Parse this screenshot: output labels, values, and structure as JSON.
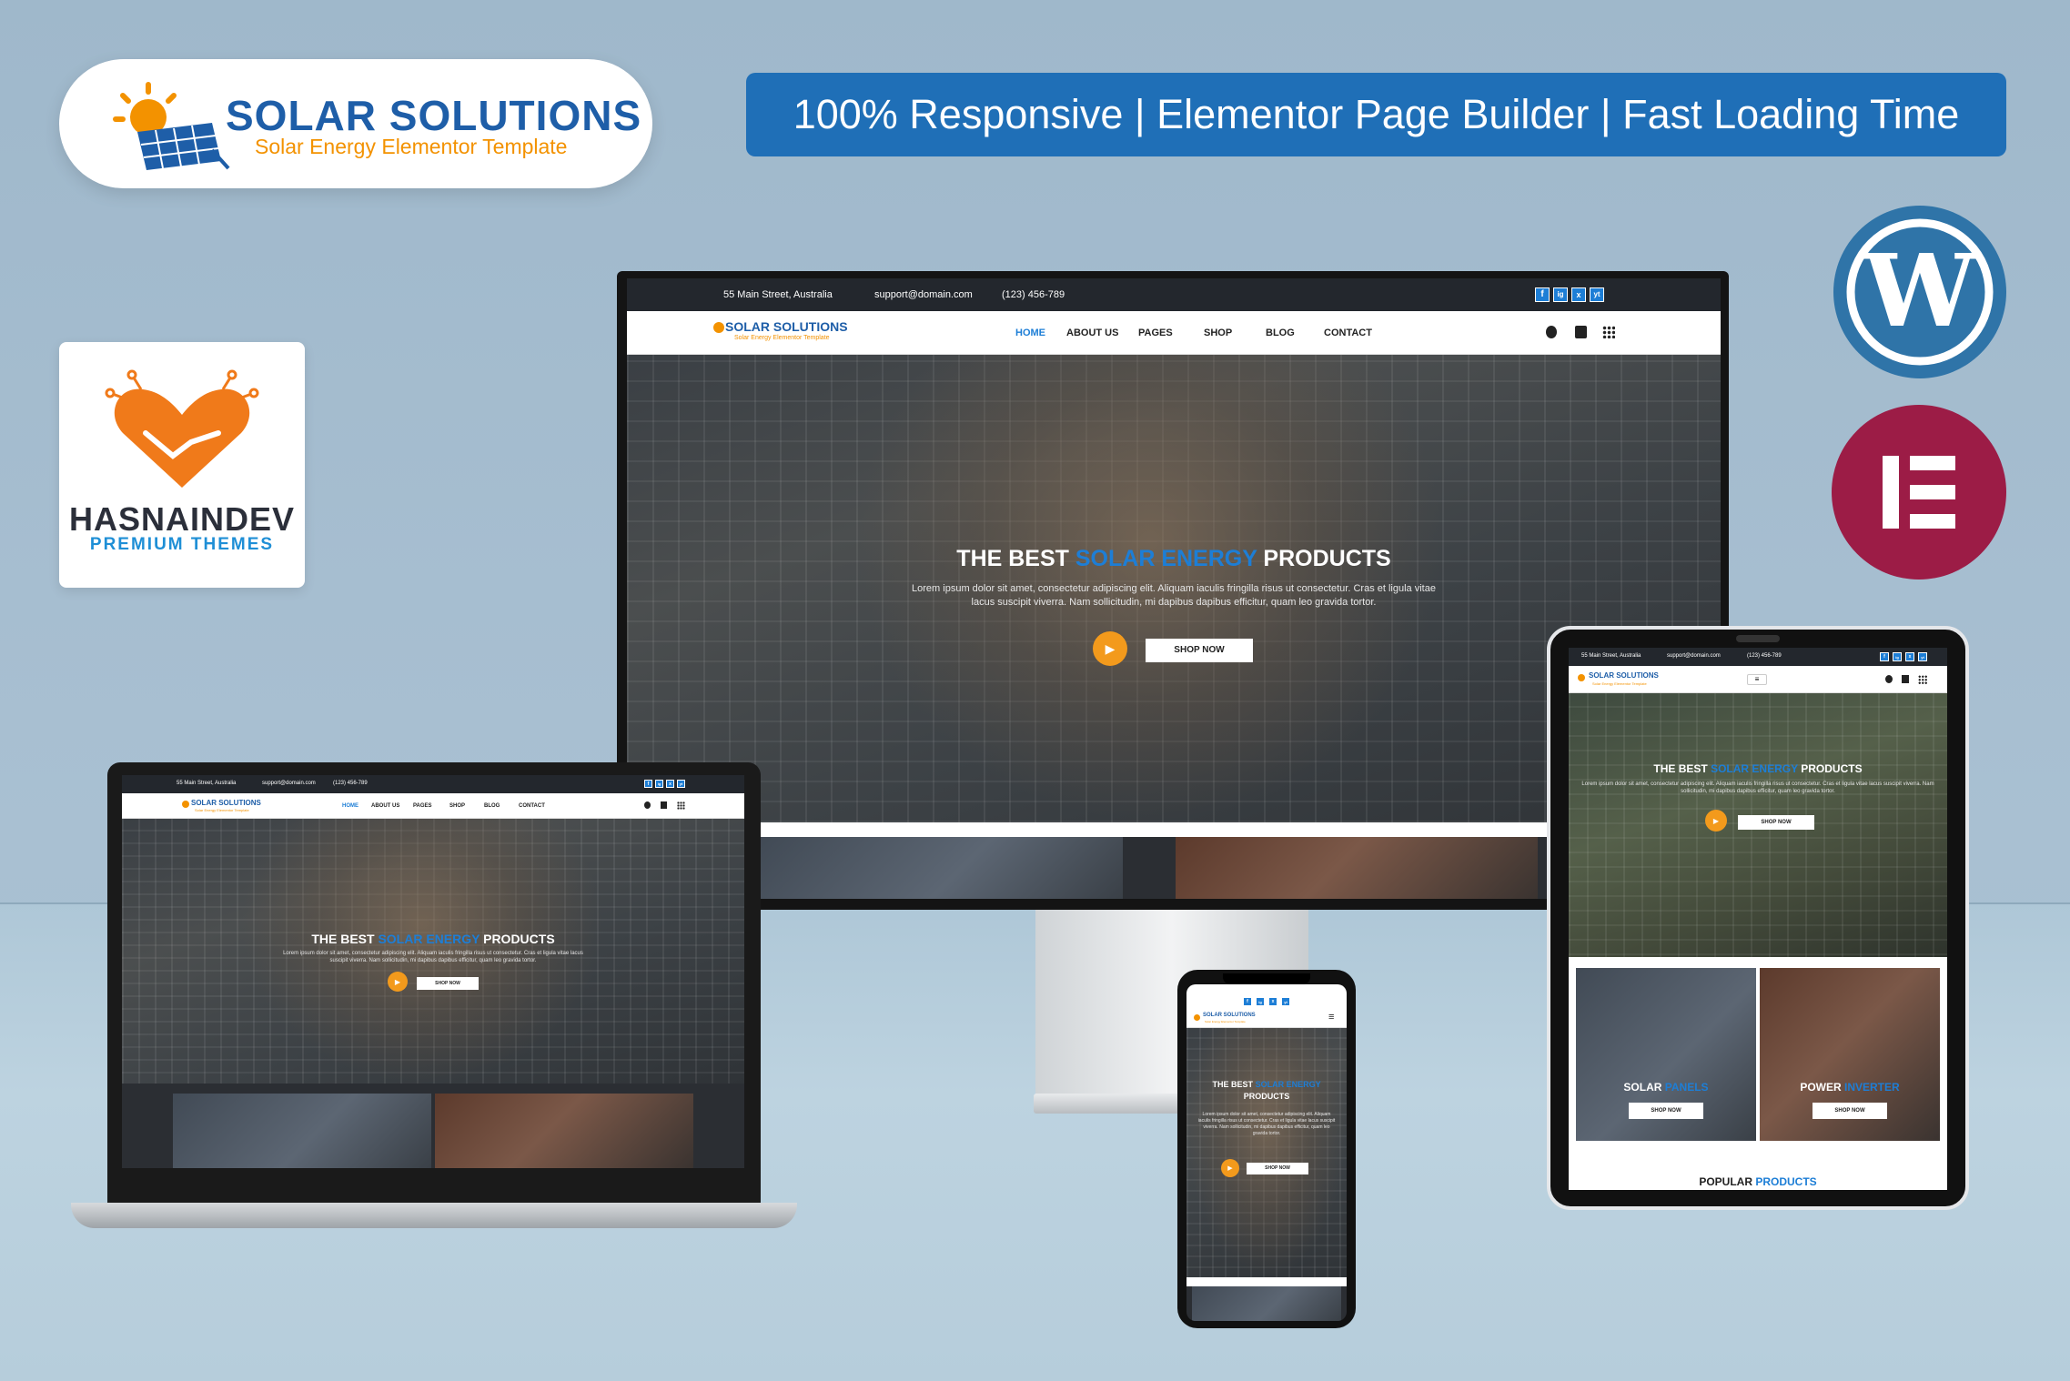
{
  "brand": {
    "title": "SOLAR SOLUTIONS",
    "subtitle": "Solar Energy Elementor Template"
  },
  "features": "100% Responsive | Elementor Page Builder | Fast Loading Time",
  "developer": {
    "name": "HASNAINDEV",
    "tagline": "PREMIUM THEMES"
  },
  "colors": {
    "accent": "#1d7ed6",
    "brand": "#1e5ea8",
    "orange": "#f39200",
    "wordpress": "#2f74a8",
    "elementor": "#9c1c46"
  },
  "site": {
    "topbar": {
      "address": "55 Main Street, Australia",
      "email": "support@domain.com",
      "phone": "(123) 456-789"
    },
    "logo": {
      "title": "SOLAR SOLUTIONS",
      "subtitle": "Solar Energy Elementor Template"
    },
    "nav": [
      "HOME",
      "ABOUT US",
      "PAGES",
      "SHOP",
      "BLOG",
      "CONTACT"
    ],
    "nav_active": "HOME",
    "hero": {
      "title_pre": "THE BEST",
      "title_highlight": "SOLAR ENERGY",
      "title_post": "PRODUCTS",
      "description": "Lorem ipsum dolor sit amet, consectetur adipiscing elit. Aliquam iaculis fringilla risus ut consectetur. Cras et ligula vitae lacus suscipit viverra. Nam sollicitudin, mi dapibus dapibus efficitur, quam leo gravida tortor.",
      "cta": "SHOP NOW"
    },
    "tiles": [
      {
        "pre": "SOLAR",
        "highlight": "PANELS",
        "cta": "SHOP NOW"
      },
      {
        "pre": "POWER",
        "highlight": "INVERTER",
        "cta": "SHOP NOW"
      }
    ],
    "popular": {
      "pre": "POPULAR",
      "highlight": "PRODUCTS"
    },
    "social": [
      "f",
      "ig",
      "x",
      "yt"
    ]
  }
}
